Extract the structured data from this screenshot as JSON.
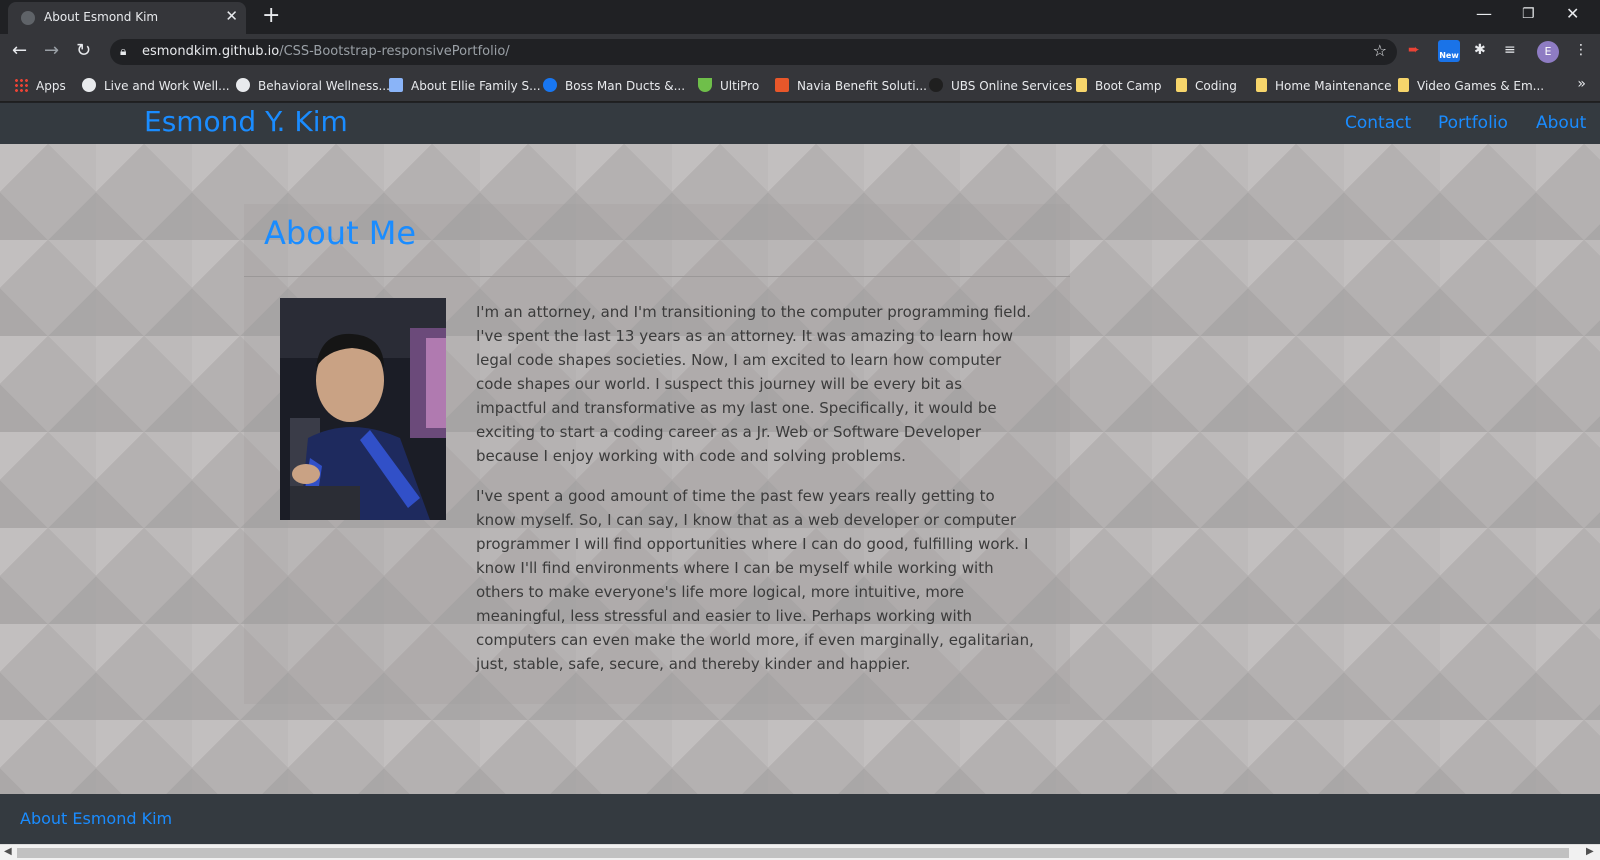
{
  "browser": {
    "tab_title": "About Esmond Kim",
    "url_host": "esmondkim.github.io",
    "url_path": "/CSS-Bootstrap-responsivePortfolio/",
    "new_badge": "New",
    "profile_initial": "E"
  },
  "bookmarks": [
    {
      "label": "Apps",
      "icon": "apps-grid-icon"
    },
    {
      "label": "Live and Work Well...",
      "icon": "globe-icon"
    },
    {
      "label": "Behavioral Wellness...",
      "icon": "globe-icon"
    },
    {
      "label": "About Ellie Family S...",
      "icon": "site-icon"
    },
    {
      "label": "Boss Man Ducts &...",
      "icon": "facebook-icon"
    },
    {
      "label": "UltiPro",
      "icon": "ultipro-icon"
    },
    {
      "label": "Navia Benefit Soluti...",
      "icon": "navia-icon"
    },
    {
      "label": "UBS Online Services",
      "icon": "ubs-icon"
    },
    {
      "label": "Boot Camp",
      "icon": "folder-icon"
    },
    {
      "label": "Coding",
      "icon": "folder-icon"
    },
    {
      "label": "Home Maintenance",
      "icon": "folder-icon"
    },
    {
      "label": "Video Games & Em...",
      "icon": "folder-icon"
    }
  ],
  "site": {
    "brand": "Esmond Y. Kim",
    "nav": [
      "Contact",
      "Portfolio",
      "About"
    ],
    "heading": "About Me",
    "paragraphs": [
      "I'm an attorney, and I'm transitioning to the computer programming field. I've spent the last 13 years as an attorney. It was amazing to learn how legal code shapes societies. Now, I am excited to learn how computer code shapes our world. I suspect this journey will be every bit as impactful and transformative as my last one. Specifically, it would be exciting to start a coding career as a Jr. Web or Software Developer because I enjoy working with code and solving problems.",
      "I've spent a good amount of time the past few years really getting to know myself. So, I can say, I know that as a web developer or computer programmer I will find opportunities where I can do good, fulfilling work. I know I'll find environments where I can be myself while working with others to make everyone's life more logical, more intuitive, more meaningful, less stressful and easier to live. Perhaps working with computers can even make the world more, if even marginally, egalitarian, just, stable, safe, secure, and thereby kinder and happier."
    ],
    "footer": "About Esmond Kim"
  },
  "colors": {
    "link_blue": "#1a8cff",
    "navbar": "#343a40",
    "page_bg": "#b4b1b1"
  }
}
